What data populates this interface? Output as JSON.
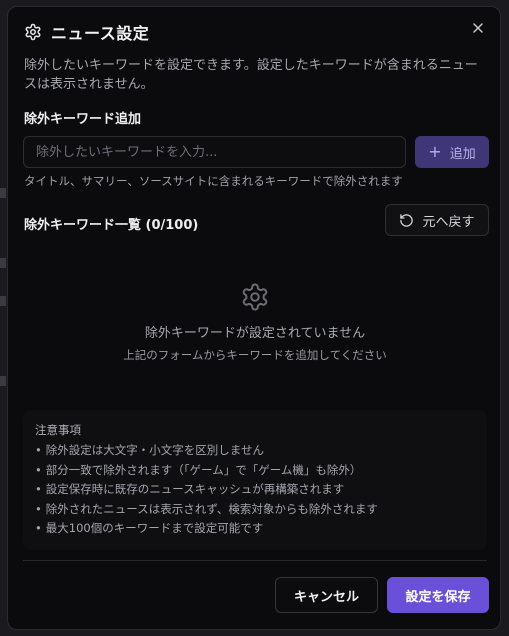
{
  "dialog": {
    "title": "ニュース設定",
    "description": "除外したいキーワードを設定できます。設定したキーワードが含まれるニュースは表示されません。"
  },
  "add_section": {
    "title": "除外キーワード追加",
    "input_placeholder": "除外したいキーワードを入力...",
    "input_value": "",
    "add_label": "追加",
    "hint": "タイトル、サマリー、ソースサイトに含まれるキーワードで除外されます"
  },
  "list_section": {
    "title": "除外キーワード一覧 (0/100)",
    "restore_label": "元へ戻す",
    "empty_message": "除外キーワードが設定されていません",
    "empty_sub": "上記のフォームからキーワードを追加してください"
  },
  "notes": {
    "title": "注意事項",
    "items": [
      "除外設定は大文字・小文字を区別しません",
      "部分一致で除外されます（「ゲーム」で「ゲーム機」も除外）",
      "設定保存時に既存のニュースキャッシュが再構築されます",
      "除外されたニュースは表示されず、検索対象からも除外されます",
      "最大100個のキーワードまで設定可能です"
    ]
  },
  "footer": {
    "cancel_label": "キャンセル",
    "save_label": "設定を保存"
  },
  "colors": {
    "accent": "#6a4fd8",
    "accent_disabled": "#3f3678",
    "dialog_bg": "#0b0b0d"
  },
  "icons": {
    "header": "gear-icon",
    "close": "close-icon",
    "add": "plus-icon",
    "restore": "rotate-ccw-icon",
    "empty": "gear-icon"
  }
}
